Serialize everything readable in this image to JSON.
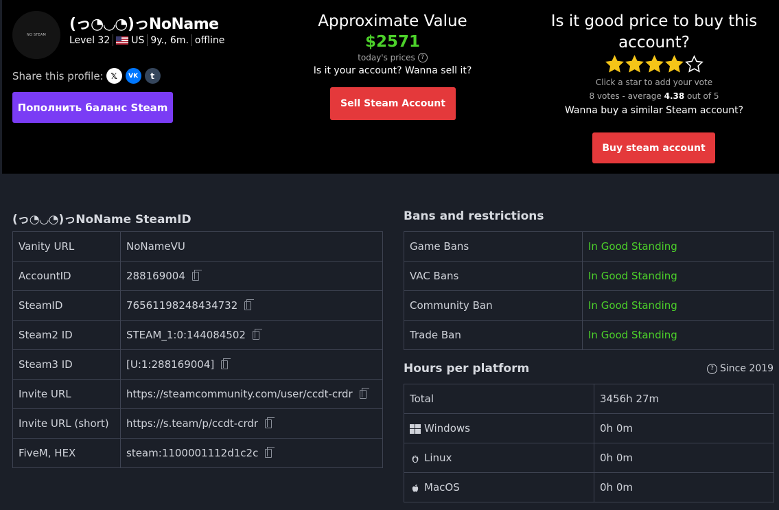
{
  "profile": {
    "avatar_text": "NO STEAM",
    "name": "(っ◔◡◔)っNoName",
    "level": "Level 32",
    "country": "US",
    "account_age": "9y., 6m.",
    "status": "offline",
    "share_label": "Share this profile:",
    "topup_label": "Пополнить баланс Steam"
  },
  "value": {
    "title": "Approximate Value",
    "price": "$2571",
    "todays_prices": "today's prices",
    "sell_question": "Is it your account? Wanna sell it?",
    "sell_button": "Sell Steam Account"
  },
  "rating": {
    "title": "Is it good price to buy this account?",
    "stars_filled": 4,
    "stars_total": 5,
    "hint": "Click a star to add your vote",
    "votes_prefix": "8 votes - average",
    "average": "4.38",
    "votes_suffix": "out of 5",
    "buy_question": "Wanna buy a similar Steam account?",
    "buy_button": "Buy steam account"
  },
  "steamid_section": {
    "title": "(っ◔◡◔)っNoName SteamID",
    "rows": [
      {
        "label": "Vanity URL",
        "value": "NoNameVU",
        "copy": false
      },
      {
        "label": "AccountID",
        "value": "288169004",
        "copy": true
      },
      {
        "label": "SteamID",
        "value": "76561198248434732",
        "copy": true
      },
      {
        "label": "Steam2 ID",
        "value": "STEAM_1:0:144084502",
        "copy": true
      },
      {
        "label": "Steam3 ID",
        "value": "[U:1:288169004]",
        "copy": true
      },
      {
        "label": "Invite URL",
        "value": "https://steamcommunity.com/user/ccdt-crdr",
        "copy": true
      },
      {
        "label": "Invite URL (short)",
        "value": "https://s.team/p/ccdt-crdr",
        "copy": true
      },
      {
        "label": "FiveM, HEX",
        "value": "steam:1100001112d1c2c",
        "copy": true
      }
    ]
  },
  "bans": {
    "title": "Bans and restrictions",
    "rows": [
      {
        "label": "Game Bans",
        "value": "In Good Standing"
      },
      {
        "label": "VAC Bans",
        "value": "In Good Standing"
      },
      {
        "label": "Community Ban",
        "value": "In Good Standing"
      },
      {
        "label": "Trade Ban",
        "value": "In Good Standing"
      }
    ]
  },
  "hours": {
    "title": "Hours per platform",
    "since": "Since 2019",
    "rows": [
      {
        "label": "Total",
        "value": "3456h 27m",
        "icon": ""
      },
      {
        "label": "Windows",
        "value": "0h 0m",
        "icon": "windows-icon"
      },
      {
        "label": "Linux",
        "value": "0h 0m",
        "icon": "linux-icon"
      },
      {
        "label": "MacOS",
        "value": "0h 0m",
        "icon": "apple-icon"
      }
    ]
  },
  "colors": {
    "background": "#1b1f28",
    "header": "#000000",
    "good": "#4cd12a",
    "accent_purple": "#7a3cf5",
    "accent_red": "#e4393b",
    "star": "#f5c518"
  }
}
